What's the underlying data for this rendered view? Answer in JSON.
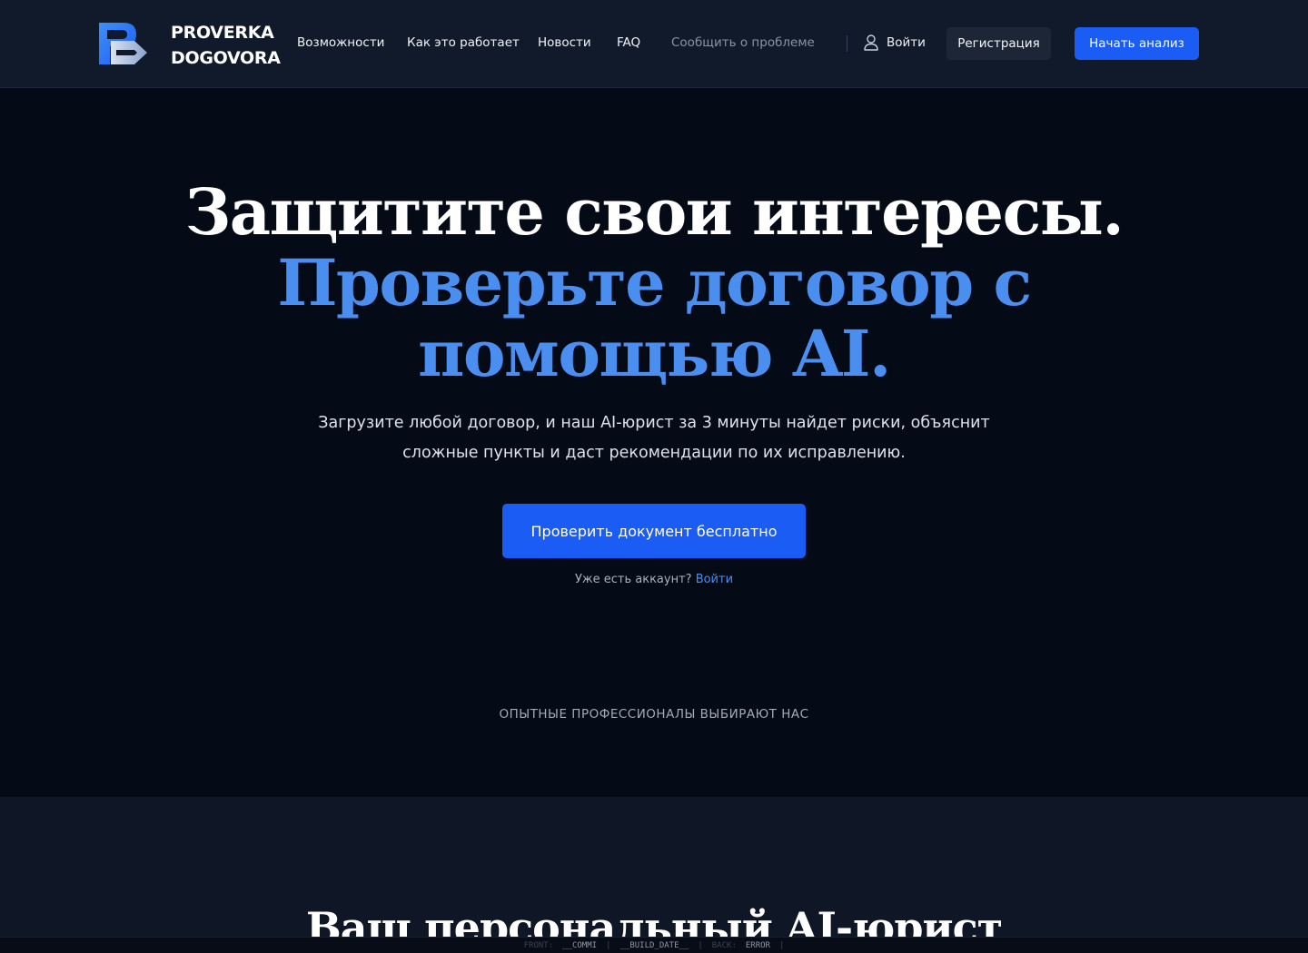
{
  "brand": {
    "line1": "PROVERKA",
    "line2": "DOGOVORA"
  },
  "nav": {
    "features": "Возможности",
    "how_it_works": "Как это работает",
    "news": "Новости",
    "faq": "FAQ",
    "report_problem": "Сообщить о проблеме",
    "login": "Войти",
    "register": "Регистрация",
    "start_analysis": "Начать анализ"
  },
  "hero": {
    "title_line1": "Защитите свои интересы.",
    "title_line2": "Проверьте договор с",
    "title_line3": "помощью AI.",
    "subtitle": "Загрузите любой договор, и наш AI-юрист за 3 минуты найдет риски, объяснит сложные пункты и даст рекомендации по их исправлению.",
    "cta": "Проверить документ бесплатно",
    "account_prompt": "Уже есть аккаунт?",
    "account_login": "Войти",
    "professionals": "ОПЫТНЫЕ ПРОФЕССИОНАЛЫ ВЫБИРАЮТ НАС"
  },
  "section2": {
    "title": "Ваш персональный AI-юрист"
  },
  "status": {
    "front_label": "FRONT:",
    "front_commit": "__COMMI",
    "sep1": "|",
    "build_date": "__BUILD_DATE__",
    "sep2": "|",
    "back_label": "BACK:",
    "back_value": "ERROR",
    "sep3": "|"
  },
  "colors": {
    "accent": "#1b5cf5",
    "highlight": "#4a8ff0",
    "header_bg": "#111a2b",
    "hero_bg": "#040a16"
  },
  "icons": {
    "logo": "pd-logo-icon",
    "user": "user-icon"
  }
}
